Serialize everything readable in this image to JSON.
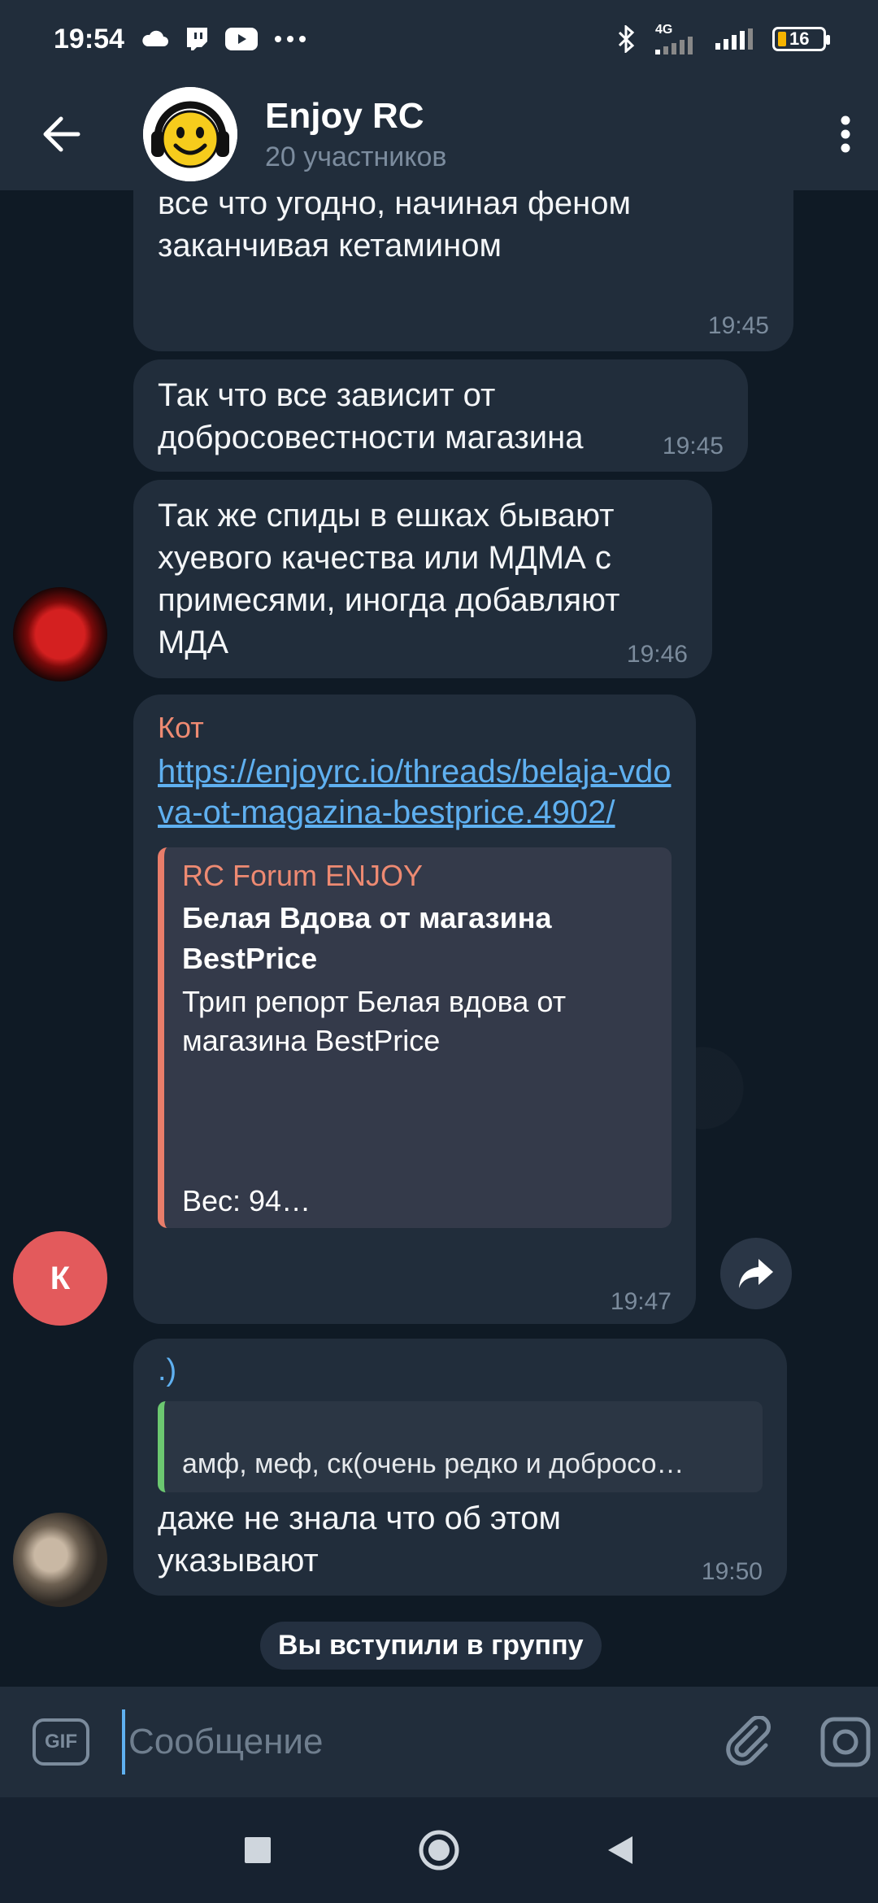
{
  "status_bar": {
    "time": "19:54",
    "network": "4G",
    "battery": "16"
  },
  "header": {
    "title": "Enjoy RC",
    "subtitle": "20 участников"
  },
  "messages": [
    {
      "text": "указывают) в целом там может быть все что угодно, начиная феном заканчивая кетамином",
      "time": "19:45"
    },
    {
      "text": "Так что все зависит от добросовестности магазина",
      "time": "19:45"
    },
    {
      "text": "Так же спиды в ешках бывают хуевого качества или МДМА с примесями, иногда добавляют МДА",
      "time": "19:46"
    },
    {
      "sender": "Кот",
      "link": "https://enjoyrc.io/threads/belaja-vdova-ot-magazina-bestprice.4902/",
      "preview": {
        "site": "RC Forum ENJOY",
        "title": "Белая Вдова  от магазина BestPrice",
        "description": "Трип репорт  Белая вдова  от магазина BestPrice",
        "footer": "Вес: 94…"
      },
      "avatar_letter": "К",
      "time": "19:47"
    },
    {
      "reply_name": ".)",
      "reply_text": "амф, меф, ск(очень редко и добросо…",
      "text": "даже не знала что об этом указывают",
      "time": "19:50"
    }
  ],
  "service_message": "Вы вступили в группу",
  "input": {
    "gif_label": "GIF",
    "placeholder": "Сообщение"
  },
  "colors": {
    "header_bg": "#212d3b",
    "chat_bg": "#0f1a25",
    "bubble_bg": "#212d3b",
    "link": "#5fb0f0",
    "sender_name": "#ee8a72",
    "avatar_k": "#e35a5c"
  }
}
